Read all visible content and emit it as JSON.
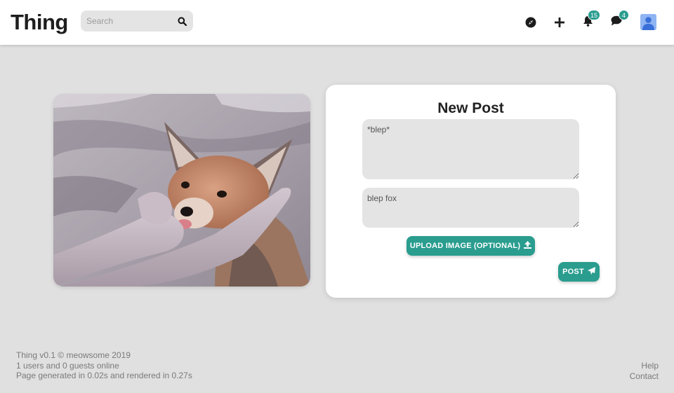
{
  "header": {
    "logo": "Thing",
    "search": {
      "placeholder": "Search",
      "icon": "search-icon"
    },
    "nav": {
      "explore": {
        "icon": "compass-icon"
      },
      "new_post": {
        "icon": "plus-icon"
      },
      "notifications": {
        "icon": "bell-icon",
        "count": "15"
      },
      "messages": {
        "icon": "chat-icon",
        "count": "4"
      },
      "profile": {
        "icon": "avatar-icon"
      }
    }
  },
  "main": {
    "image": {
      "subject": "fox-photo"
    },
    "post_form": {
      "title": "New Post",
      "content_value": "*blep*",
      "tags_value": "blep fox",
      "upload_label": "UPLOAD IMAGE (OPTIONAL)",
      "post_label": "POST"
    }
  },
  "footer": {
    "version_line": "Thing v0.1 © meowsome 2019",
    "online_line": "1 users and 0 guests online",
    "timing_line": "Page generated in 0.02s and rendered in 0.27s",
    "help": "Help",
    "contact": "Contact"
  },
  "colors": {
    "accent": "#2a9d8f",
    "background": "#e0e0e0",
    "card": "#ffffff"
  }
}
